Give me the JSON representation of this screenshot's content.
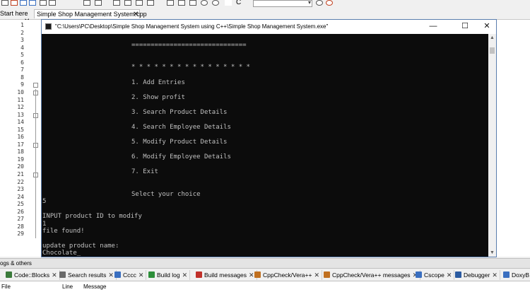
{
  "toolbar": {
    "combo_value": ""
  },
  "tabs": {
    "start": "Start here",
    "file": "Simple Shop Management System.cpp"
  },
  "editor": {
    "line_numbers": [
      "1",
      "2",
      "3",
      "4",
      "5",
      "6",
      "7",
      "8",
      "9",
      "10",
      "11",
      "12",
      "13",
      "14",
      "15",
      "16",
      "17",
      "18",
      "19",
      "20",
      "21",
      "22",
      "23",
      "24",
      "25",
      "26",
      "27",
      "28",
      "29"
    ]
  },
  "console": {
    "title": "\"C:\\Users\\PC\\Desktop\\Simple Shop Management System using C++\\Simple Shop Management System.exe\"",
    "separator": "==============================",
    "stars": "* * * * * * * * * * * * * * * *",
    "menu": [
      "1. Add Entries",
      "2. Show profit",
      "3. Search Product Details",
      "4. Search Employee Details",
      "5. Modify Product Details",
      "6. Modify Employee Details",
      "7. Exit"
    ],
    "prompt": "Select your choice",
    "choice": "5",
    "input_prompt": "INPUT product ID to modify",
    "product_id": "1",
    "file_found": "file found!",
    "update_prompt": "update product name:",
    "typed": "Chocolate_"
  },
  "logs": {
    "title": "ogs & others",
    "tabs": [
      "Code::Blocks",
      "Search results",
      "Cccc",
      "Build log",
      "Build messages",
      "CppCheck/Vera++",
      "CppCheck/Vera++ messages",
      "Cscope",
      "Debugger",
      "DoxyB"
    ],
    "columns": {
      "file": "File",
      "line": "Line",
      "message": "Message"
    }
  },
  "colors": {
    "console_bg": "#0c0c0c",
    "console_text": "#c0c0c0",
    "accent": "#5a7dad"
  }
}
